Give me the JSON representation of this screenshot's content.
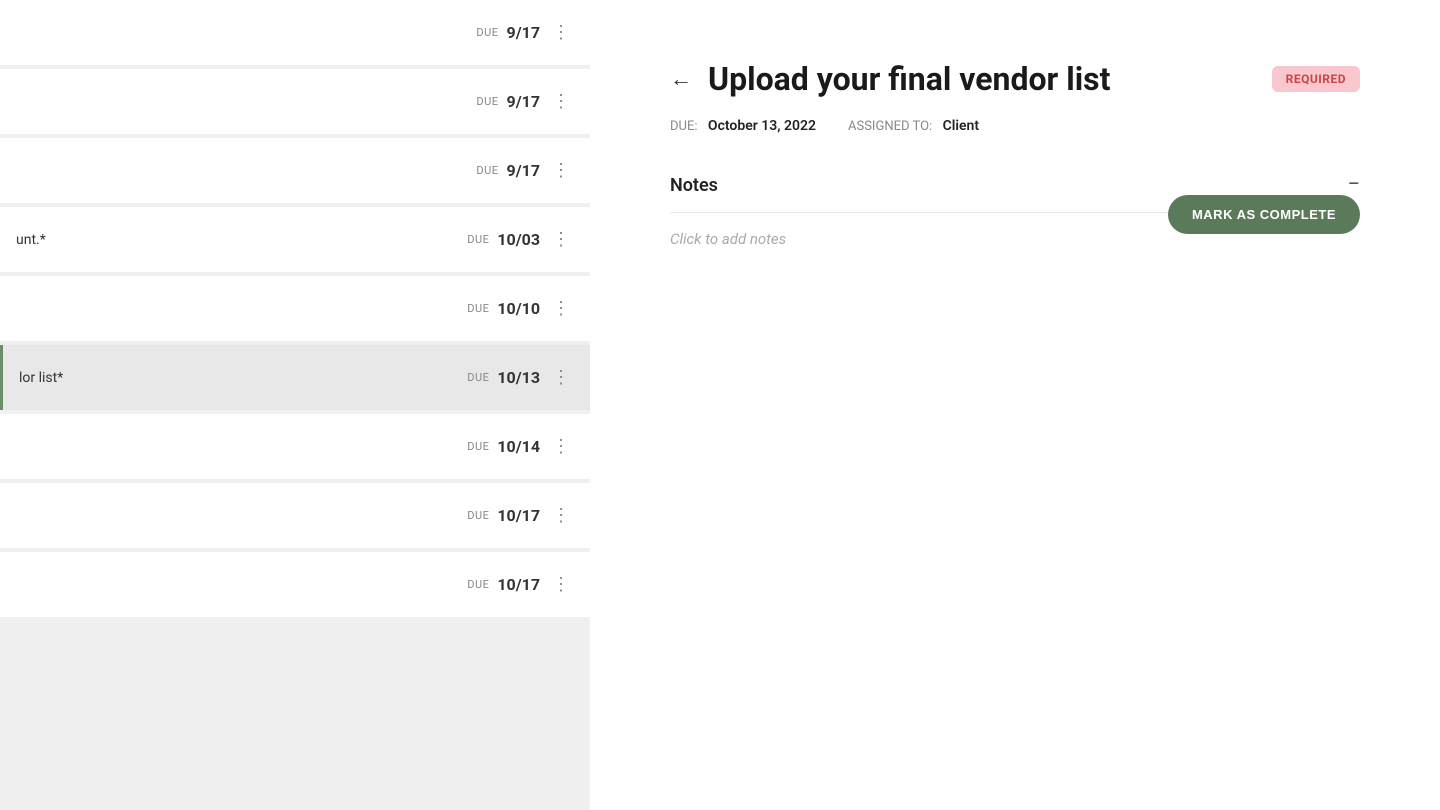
{
  "left_panel": {
    "tasks": [
      {
        "id": 1,
        "label": "",
        "due_label": "DUE",
        "due_date": "9/17",
        "active": false
      },
      {
        "id": 2,
        "label": "",
        "due_label": "DUE",
        "due_date": "9/17",
        "active": false
      },
      {
        "id": 3,
        "label": "",
        "due_label": "DUE",
        "due_date": "9/17",
        "active": false
      },
      {
        "id": 4,
        "label": "unt.*",
        "due_label": "DUE",
        "due_date": "10/03",
        "active": false
      },
      {
        "id": 5,
        "label": "",
        "due_label": "DUE",
        "due_date": "10/10",
        "active": false
      },
      {
        "id": 6,
        "label": "lor list*",
        "due_label": "DUE",
        "due_date": "10/13",
        "active": true
      },
      {
        "id": 7,
        "label": "",
        "due_label": "DUE",
        "due_date": "10/14",
        "active": false
      },
      {
        "id": 8,
        "label": "",
        "due_label": "DUE",
        "due_date": "10/17",
        "active": false
      },
      {
        "id": 9,
        "label": "",
        "due_label": "DUE",
        "due_date": "10/17",
        "active": false
      }
    ]
  },
  "right_panel": {
    "back_label": "←",
    "title": "Upload your final vendor list",
    "required_badge": "REQUIRED",
    "due_label": "DUE:",
    "due_value": "October 13, 2022",
    "assigned_label": "ASSIGNED TO:",
    "assigned_value": "Client",
    "mark_complete_label": "MARK AS COMPLETE",
    "notes_title": "Notes",
    "notes_collapse": "−",
    "notes_placeholder": "Click to add notes"
  }
}
